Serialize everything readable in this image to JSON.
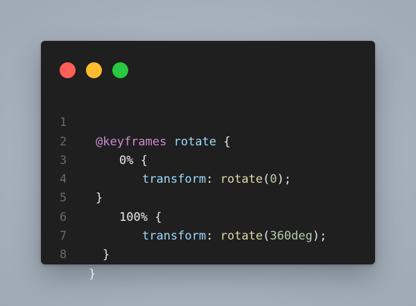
{
  "colors": {
    "background": "#a9b4bf",
    "window": "#1f1f1f",
    "close": "#ff5f57",
    "minimize": "#febc2e",
    "maximize": "#28c840",
    "keyword": "#d08bd0",
    "function": "#dcdcaa",
    "property": "#9cdcfe",
    "number": "#b5cea8",
    "text": "#e9e9e9",
    "line_number": "#6c6c6c"
  },
  "window_controls": [
    {
      "name": "close-button",
      "icon": "red-circle"
    },
    {
      "name": "minimize-button",
      "icon": "yellow-circle"
    },
    {
      "name": "maximize-button",
      "icon": "green-circle"
    }
  ],
  "code": {
    "lines": [
      {
        "n": "1",
        "t1": "@keyframes",
        "t2": " ",
        "t3": "rotate",
        "t4": " {"
      },
      {
        "n": "2",
        "t1": "0%",
        "t2": " {"
      },
      {
        "n": "3",
        "t1": "transform",
        "t2": ": ",
        "t3": "rotate",
        "t4": "(",
        "t5": "0",
        "t6": ");"
      },
      {
        "n": "4",
        "t1": "}"
      },
      {
        "n": "5",
        "t1": "100%",
        "t2": " {"
      },
      {
        "n": "6",
        "t1": "transform",
        "t2": ": ",
        "t3": "rotate",
        "t4": "(",
        "t5": "360deg",
        "t6": ");"
      },
      {
        "n": "7",
        "t1": "}"
      },
      {
        "n": "8",
        "t1": "}"
      }
    ]
  }
}
